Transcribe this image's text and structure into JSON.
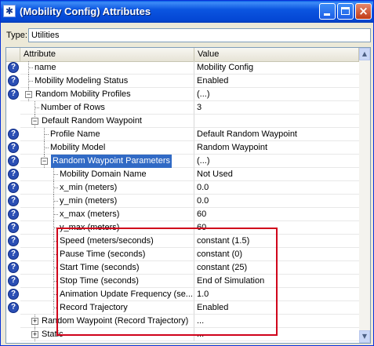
{
  "window": {
    "title": "(Mobility Config) Attributes",
    "app_icon": "star-icon",
    "buttons": {
      "minimize": "minimize-icon",
      "maximize": "maximize-icon",
      "close": "×"
    }
  },
  "type": {
    "label": "Type:",
    "value": "Utilities"
  },
  "grid": {
    "headers": {
      "attribute": "Attribute",
      "value": "Value"
    },
    "rows": [
      {
        "attr": "name",
        "value": "Mobility Config"
      },
      {
        "attr": "Mobility Modeling Status",
        "value": "Enabled"
      },
      {
        "attr": "Random Mobility Profiles",
        "value": "(...)"
      },
      {
        "attr": "Number of Rows",
        "value": "3"
      },
      {
        "attr": "Default Random Waypoint",
        "value": ""
      },
      {
        "attr": "Profile Name",
        "value": "Default Random Waypoint"
      },
      {
        "attr": "Mobility Model",
        "value": "Random Waypoint"
      },
      {
        "attr": "Random Waypoint Parameters",
        "value": "(...)"
      },
      {
        "attr": "Mobility Domain Name",
        "value": "Not Used"
      },
      {
        "attr": "x_min (meters)",
        "value": "0.0"
      },
      {
        "attr": "y_min (meters)",
        "value": "0.0"
      },
      {
        "attr": "x_max (meters)",
        "value": "60"
      },
      {
        "attr": "y_max (meters)",
        "value": "60"
      },
      {
        "attr": "Speed (meters/seconds)",
        "value": "constant (1.5)"
      },
      {
        "attr": "Pause Time (seconds)",
        "value": "constant (0)"
      },
      {
        "attr": "Start Time (seconds)",
        "value": "constant (25)"
      },
      {
        "attr": "Stop Time (seconds)",
        "value": "End of Simulation"
      },
      {
        "attr": "Animation Update Frequency (se...",
        "value": "1.0"
      },
      {
        "attr": "Record Trajectory",
        "value": "Enabled"
      },
      {
        "attr": "Random Waypoint (Record Trajectory)",
        "value": "..."
      },
      {
        "attr": "Static",
        "value": "..."
      }
    ]
  },
  "colors": {
    "title_bar": "#0b55e0",
    "selection": "#316ac5",
    "highlight_border": "#d0021b"
  }
}
